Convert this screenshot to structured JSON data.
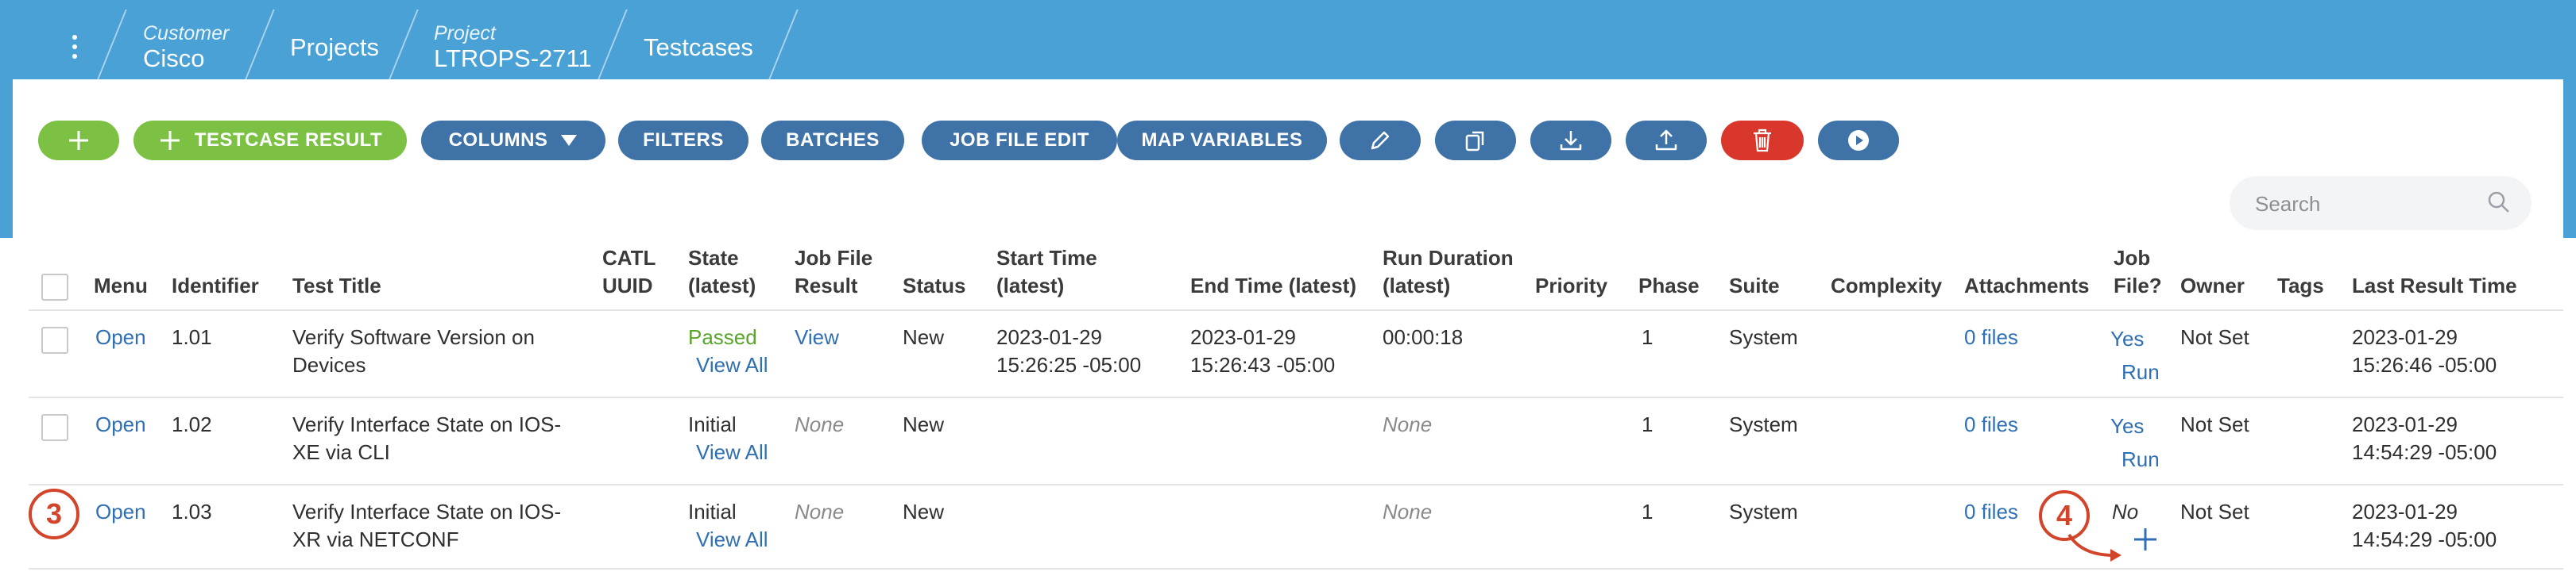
{
  "breadcrumb": {
    "customer_label": "Customer",
    "customer_value": "Cisco",
    "projects": "Projects",
    "project_label": "Project",
    "project_value": "LTROPS-2711",
    "testcases": "Testcases"
  },
  "toolbar": {
    "testcase_result_label": "TESTCASE RESULT",
    "columns_label": "COLUMNS",
    "filters_label": "FILTERS",
    "batches_label": "BATCHES",
    "job_file_edit_label": "JOB FILE EDIT",
    "map_variables_label": "MAP VARIABLES",
    "icons": [
      "plus-icon",
      "pencil-icon",
      "copy-icon",
      "download-icon",
      "upload-icon",
      "trash-icon",
      "play-icon"
    ],
    "colors": {
      "green": "#7cc144",
      "blue": "#3f73a8",
      "red": "#d9372b"
    }
  },
  "search": {
    "placeholder": "Search"
  },
  "table": {
    "headers": {
      "menu": "Menu",
      "identifier": "Identifier",
      "test_title": "Test Title",
      "catl_uuid_1": "CATL",
      "catl_uuid_2": "UUID",
      "state_1": "State",
      "state_2": "(latest)",
      "job_file_result_1": "Job File",
      "job_file_result_2": "Result",
      "status": "Status",
      "start_time_1": "Start Time",
      "start_time_2": "(latest)",
      "end_time": "End Time (latest)",
      "run_duration_1": "Run Duration",
      "run_duration_2": "(latest)",
      "priority": "Priority",
      "phase": "Phase",
      "suite": "Suite",
      "complexity": "Complexity",
      "attachments": "Attachments",
      "job_file_1": "Job",
      "job_file_2": "File?",
      "owner": "Owner",
      "tags": "Tags",
      "last_result_time": "Last Result Time"
    },
    "rows": [
      {
        "menu": "Open",
        "identifier": "1.01",
        "title_1": "Verify Software Version on",
        "title_2": "Devices",
        "state": "Passed",
        "view_all": "View All",
        "job_file_result": "View",
        "status": "New",
        "start_1": "2023-01-29",
        "start_2": "15:26:25 -05:00",
        "end_1": "2023-01-29",
        "end_2": "15:26:43 -05:00",
        "duration": "00:00:18",
        "phase": "1",
        "suite": "System",
        "attachments": "0 files",
        "job_file": "Yes",
        "run": "Run",
        "owner": "Not Set",
        "last_1": "2023-01-29",
        "last_2": "15:26:46 -05:00"
      },
      {
        "menu": "Open",
        "identifier": "1.02",
        "title_1": "Verify Interface State on IOS-",
        "title_2": "XE via CLI",
        "state": "Initial",
        "view_all": "View All",
        "job_file_result": "None",
        "status": "New",
        "duration": "None",
        "phase": "1",
        "suite": "System",
        "attachments": "0 files",
        "job_file": "Yes",
        "run": "Run",
        "owner": "Not Set",
        "last_1": "2023-01-29",
        "last_2": "14:54:29 -05:00"
      },
      {
        "menu": "Open",
        "identifier": "1.03",
        "title_1": "Verify Interface State on IOS-",
        "title_2": "XR via NETCONF",
        "state": "Initial",
        "view_all": "View All",
        "job_file_result": "None",
        "status": "New",
        "duration": "None",
        "phase": "1",
        "suite": "System",
        "attachments": "0 files",
        "job_file": "No",
        "owner": "Not Set",
        "last_1": "2023-01-29",
        "last_2": "14:54:29 -05:00"
      }
    ]
  },
  "callouts": {
    "left": "3",
    "right": "4",
    "color": "#d2452a"
  }
}
